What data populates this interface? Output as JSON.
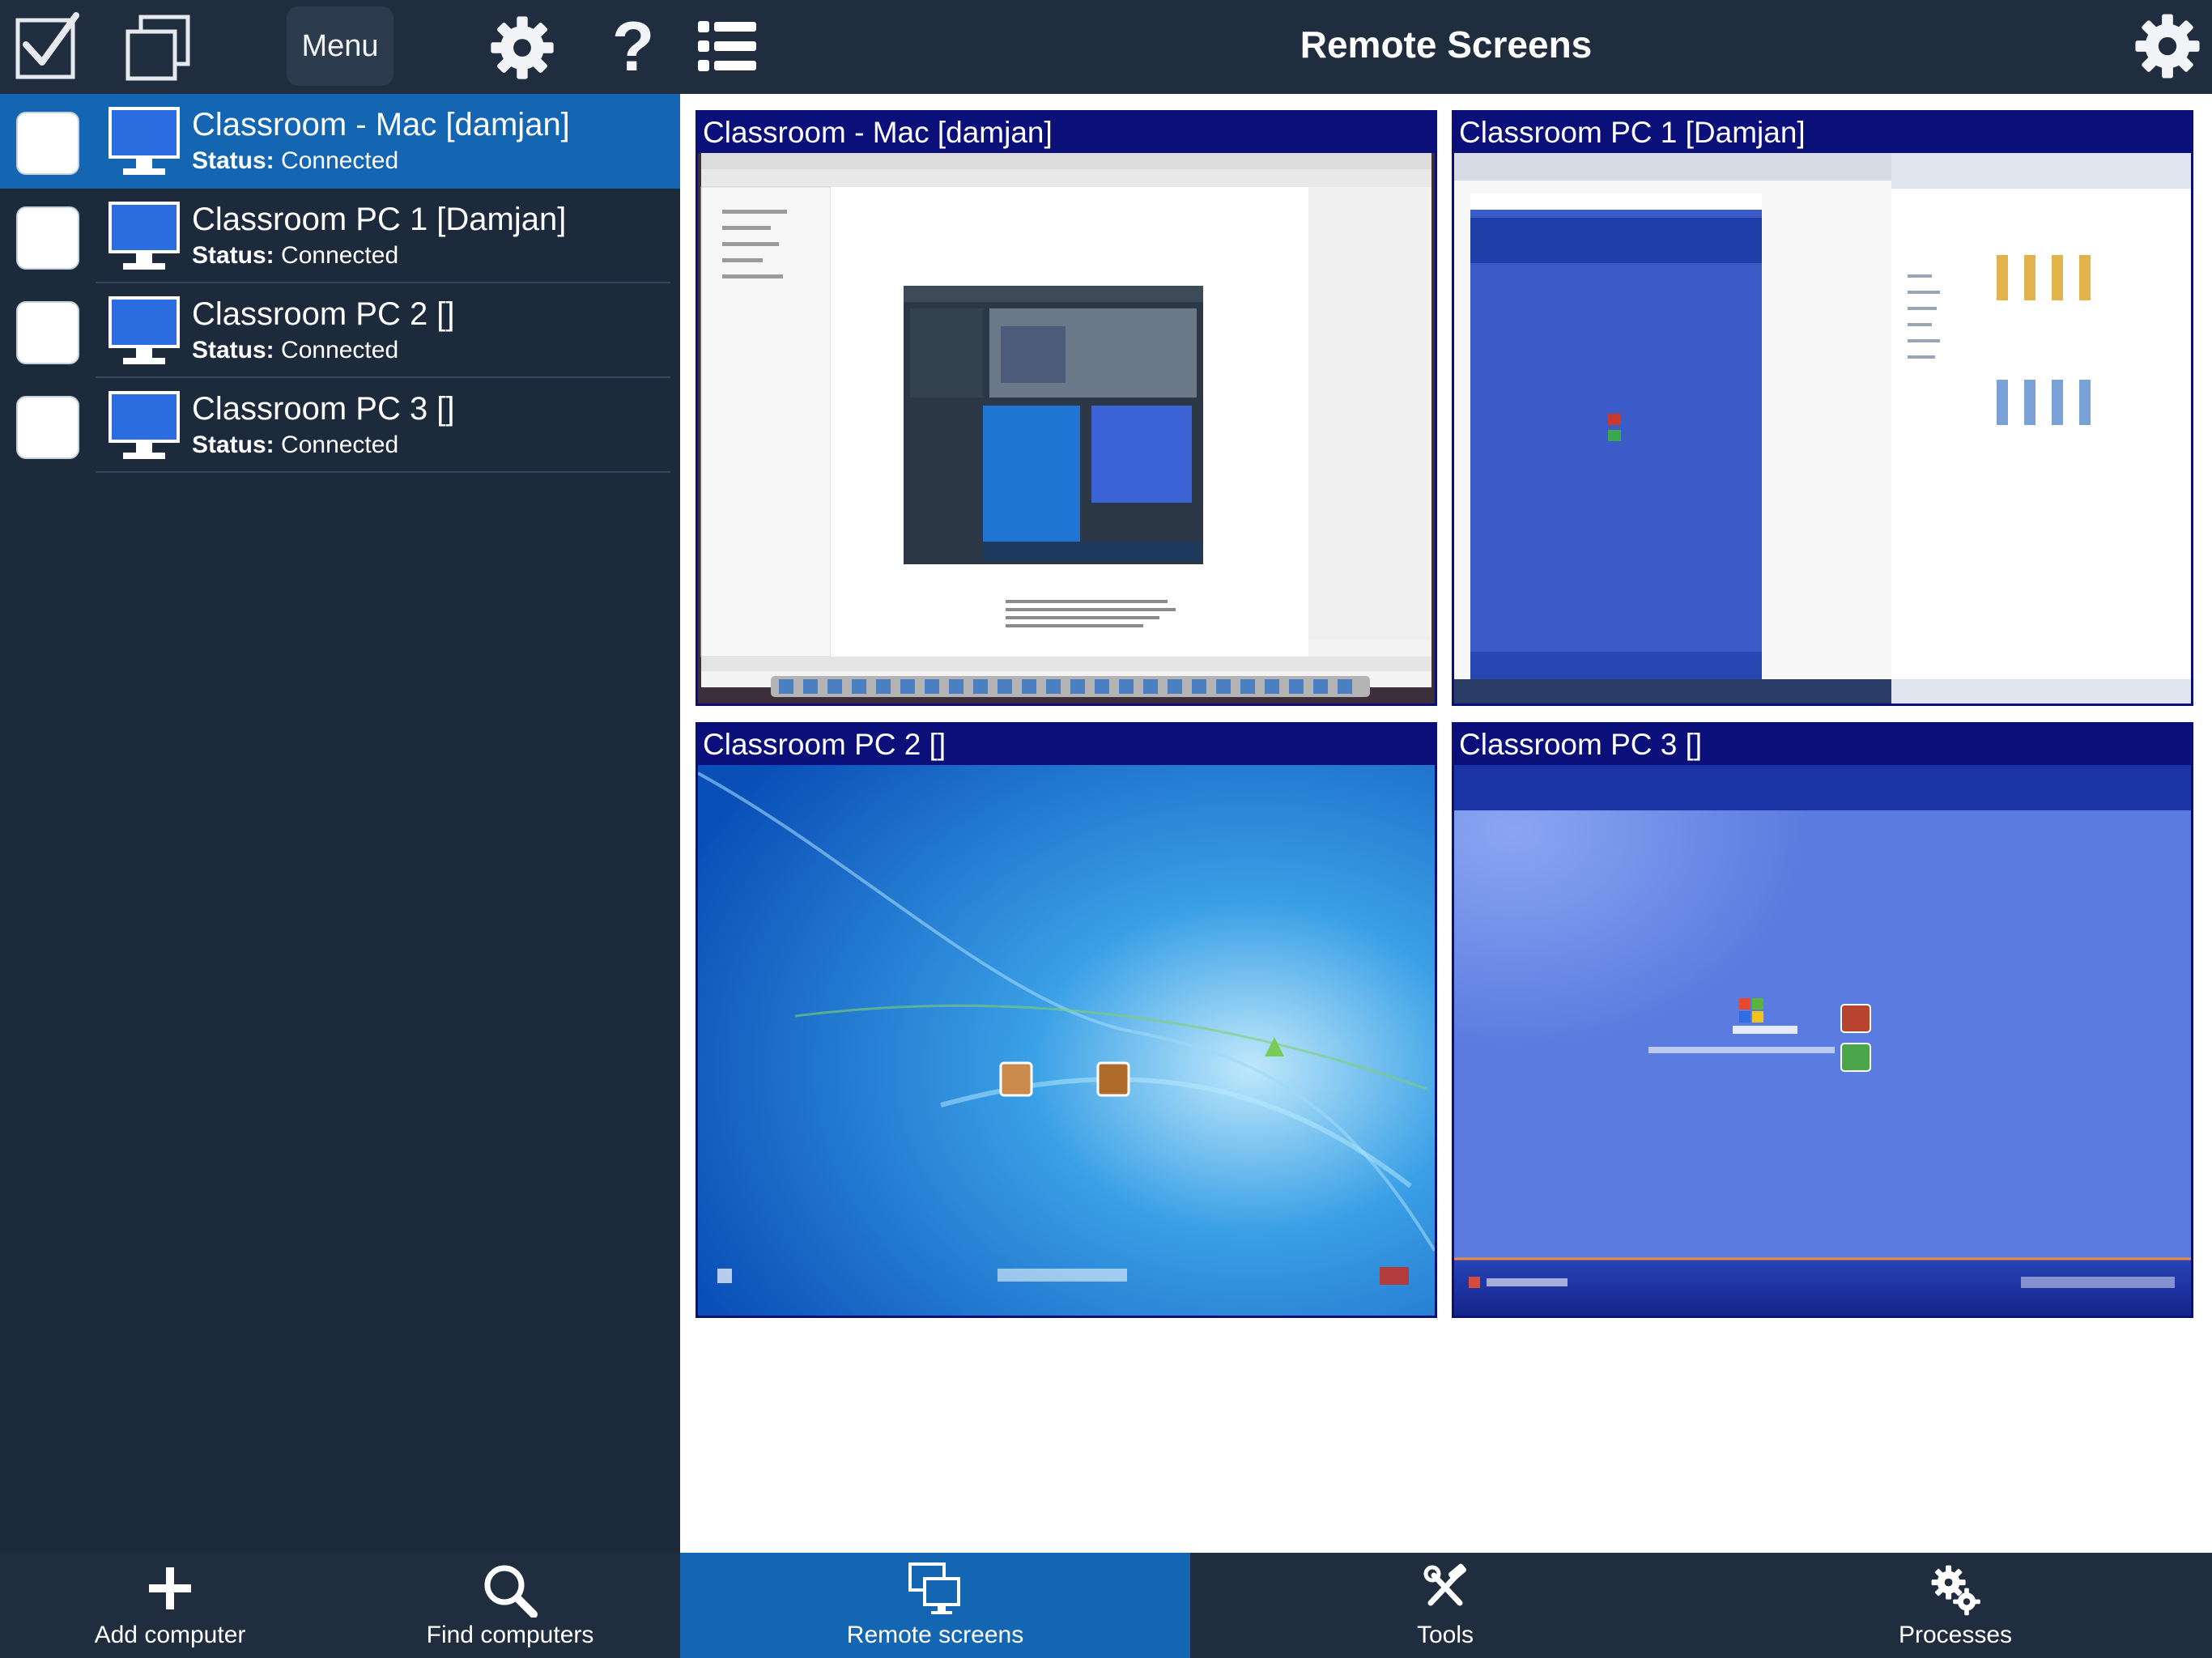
{
  "sidebar": {
    "toolbar": {
      "menu_label": "Menu",
      "help_label": "?"
    },
    "items": [
      {
        "name": "Classroom - Mac [damjan]",
        "status_label": "Status:",
        "status_value": "Connected"
      },
      {
        "name": "Classroom PC 1 [Damjan]",
        "status_label": "Status:",
        "status_value": "Connected"
      },
      {
        "name": "Classroom PC 2 []",
        "status_label": "Status:",
        "status_value": "Connected"
      },
      {
        "name": "Classroom PC 3 []",
        "status_label": "Status:",
        "status_value": "Connected"
      }
    ],
    "bottom": {
      "add_label": "Add computer",
      "find_label": "Find computers"
    }
  },
  "header": {
    "title": "Remote Screens"
  },
  "screens": [
    {
      "title": "Classroom - Mac [damjan]"
    },
    {
      "title": "Classroom PC 1 [Damjan]"
    },
    {
      "title": "Classroom PC 2 []"
    },
    {
      "title": "Classroom PC 3 []"
    }
  ],
  "tabs": [
    {
      "label": "Remote screens"
    },
    {
      "label": "Tools"
    },
    {
      "label": "Processes"
    }
  ],
  "colors": {
    "selected": "#1465b2",
    "sidebar_bg": "#1c2a3c",
    "screen_title_bg": "#0a0f7a"
  }
}
